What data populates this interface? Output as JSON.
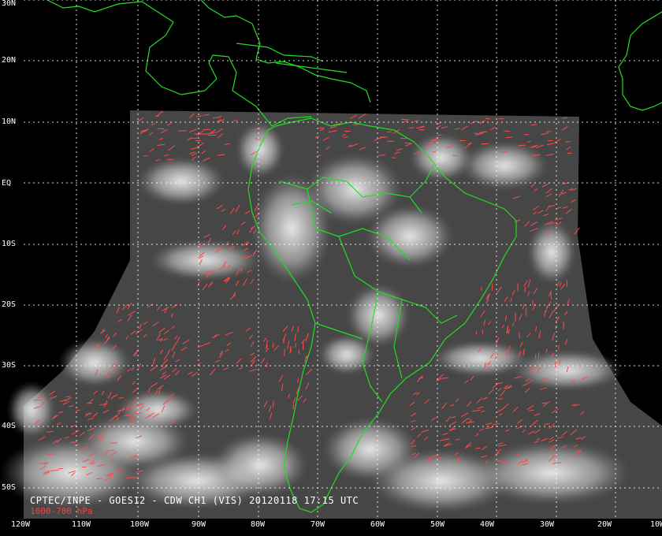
{
  "caption": {
    "line1": "CPTEC/INPE - GOES12 - CDW CH1 (VIS) 20120118 17:15 UTC",
    "line2": "1000-700 hPa",
    "line1_color": "#ffffff",
    "line2_color": "#ff4040"
  },
  "grid": {
    "lat_labels": [
      "30N",
      "20N",
      "10N",
      "EQ",
      "10S",
      "20S",
      "30S",
      "40S",
      "50S"
    ],
    "lon_labels": [
      "120W",
      "110W",
      "100W",
      "90W",
      "80W",
      "70W",
      "60W",
      "50W",
      "40W",
      "30W",
      "20W",
      "10W"
    ],
    "line_color": "#ffffff",
    "style": "dotted"
  },
  "colors": {
    "coastline": "#22dd22",
    "wind_vectors": "#ff4a4a",
    "background": "#000000",
    "imagery": "#4a4a4a"
  }
}
